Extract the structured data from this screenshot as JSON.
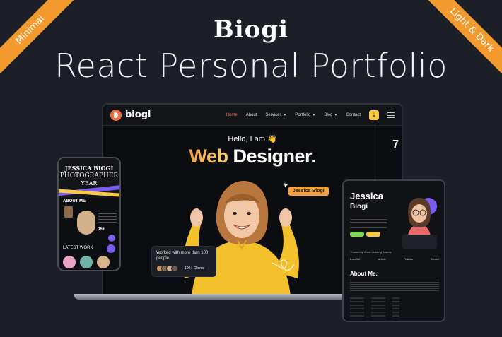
{
  "banner": {
    "ribbon_left": "Minimal",
    "ribbon_right": "Light & Dark",
    "brand": "Biogi",
    "headline": "React Personal Portfolio"
  },
  "laptop": {
    "logo_text": "biogi",
    "nav": [
      "Home",
      "About",
      "Services",
      "Portfolio",
      "Blog",
      "Contact"
    ],
    "hero_hello": "Hello, I am 👋",
    "hero_role_accent": "Web",
    "hero_role_rest": " Designer.",
    "side_number": "7",
    "name_tag": "Jessica Biogi",
    "clients_title": "Worked with more than 100 people",
    "clients_count": "100+ Clients"
  },
  "phone": {
    "title": "JESSICA BIOGI",
    "subtitle": "PHOTOGRAPHER",
    "year": "YEAR",
    "about": "ABOUT ME",
    "stat": "06+",
    "latest_work": "LATEST WORK"
  },
  "tablet": {
    "name_first": "Jessica",
    "name_last": "Biogi",
    "trusted": "Trusted by Word Leading Brands",
    "logos": [
      "travelful",
      "airbnb",
      "Pinkfas",
      "Brimer"
    ],
    "about": "About Me."
  },
  "colors": {
    "background": "#1c1f26",
    "ribbon": "#f29a2e",
    "accent_orange": "#f4a23f",
    "accent_purple": "#7c5cf0",
    "nav_active": "#ff6b4a"
  }
}
